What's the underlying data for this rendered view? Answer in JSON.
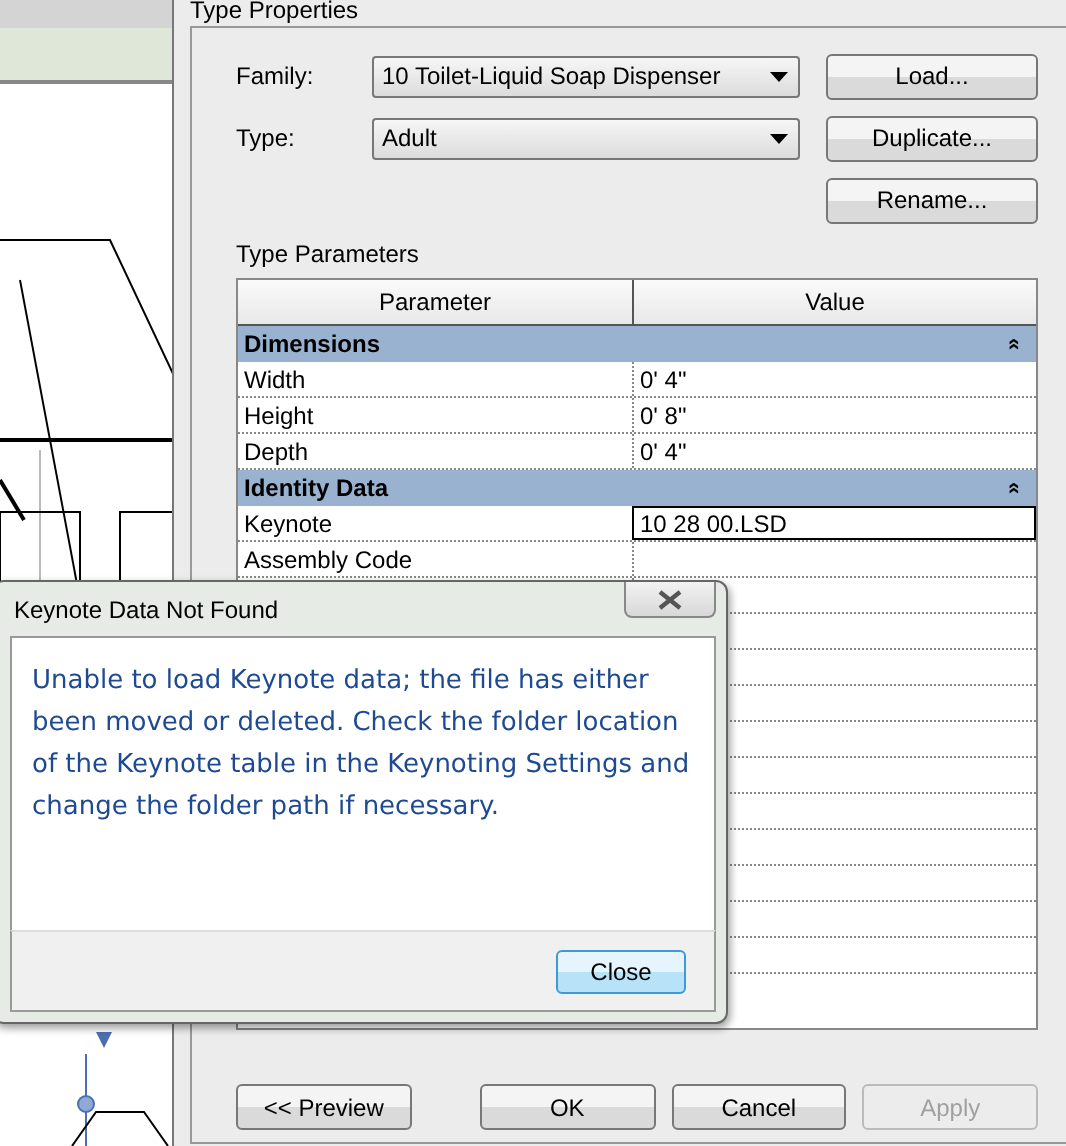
{
  "dialog": {
    "title": "Type Properties",
    "fields": [
      {
        "label": "Family:",
        "value": "10 Toilet-Liquid Soap Dispenser",
        "button": "Load..."
      },
      {
        "label": "Type:",
        "value": "Adult",
        "button": "Duplicate..."
      }
    ],
    "rename_button": "Rename...",
    "section_label": "Type Parameters",
    "table": {
      "columns": [
        "Parameter",
        "Value"
      ],
      "groups": [
        {
          "name": "Dimensions",
          "toggle": "«",
          "rows": [
            {
              "parameter": "Width",
              "value": "0'  4\"",
              "selected": false
            },
            {
              "parameter": "Height",
              "value": "0'  8\"",
              "selected": false
            },
            {
              "parameter": "Depth",
              "value": "0'  4\"",
              "selected": false
            }
          ]
        },
        {
          "name": "Identity Data",
          "toggle": "«",
          "rows": [
            {
              "parameter": "Keynote",
              "value": "10 28 00.LSD",
              "selected": true
            },
            {
              "parameter": "Assembly Code",
              "value": "",
              "selected": false
            }
          ]
        }
      ]
    },
    "buttons": [
      {
        "label": "<< Preview",
        "disabled": false
      },
      {
        "label": "OK",
        "disabled": false
      },
      {
        "label": "Cancel",
        "disabled": false
      },
      {
        "label": "Apply",
        "disabled": true
      }
    ]
  },
  "message_box": {
    "title": "Keynote Data Not Found",
    "message": "Unable to load Keynote data; the file has either been moved or deleted. Check the folder location of the Keynote table in the Keynoting Settings and change the folder path if necessary.",
    "button": "Close"
  }
}
